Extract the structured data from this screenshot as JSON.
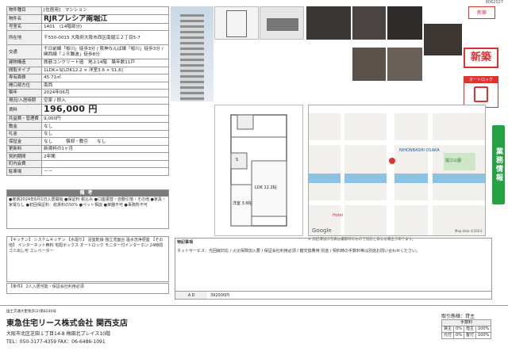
{
  "spec_rows": [
    {
      "label": "物件種目",
      "value": "[住居用]　マンション"
    },
    {
      "label": "物件名",
      "value": "RJRプレシア南堀江"
    },
    {
      "label": "号室名",
      "value": "1401　(14階部分)"
    },
    {
      "label": "所在地",
      "value": "〒550-0015 大阪府大阪市西区南堀江２丁目5-7"
    },
    {
      "label": "交通",
      "value": "千日前線「桜川」徒歩3分 / 阪神なんば線「桜川」徒歩3分 / 関西線「ＪＲ難波」徒歩8分"
    },
    {
      "label": "建物構造",
      "value": "鉄筋コンクリート造　地上14階　築年数11戸"
    },
    {
      "label": "間取タイプ",
      "value": "1LDK+S[LDK12.2 × 洋室3.6 × S1.6]"
    },
    {
      "label": "専有面積",
      "value": "45.71㎡"
    },
    {
      "label": "開口部方位",
      "value": "南西"
    },
    {
      "label": "築年",
      "value": "2024年06月"
    },
    {
      "label": "現況/入居時期",
      "value": "空家 / 即入"
    }
  ],
  "rent_label": "賃料",
  "rent_value": "196,000 円",
  "badge_new": "新築",
  "fee_rows": [
    {
      "label": "共益費・管理費",
      "value": "9,000円"
    },
    {
      "label": "敷金",
      "value": "なし"
    },
    {
      "label": "礼金",
      "value": "なし"
    },
    {
      "label": "保証金",
      "value": "なし　　　償却・敷引　　なし"
    },
    {
      "label": "更新料",
      "value": "新賃料の1ヶ月"
    },
    {
      "label": "契約期間",
      "value": "2年間"
    },
    {
      "label": "町内会費",
      "value": ""
    },
    {
      "label": "駐車場",
      "value": "－－"
    }
  ],
  "notes_head": "備考",
  "notes_text": "●家賃2024年6月1日入居開始 ●保証料 税込み ●口座振替・自動引落・その他 ●家具・家電なし ●初回保証料：総賃料の50% ●ペット相談 ●楽器不可 ●事務所不可",
  "equip_text": "【キッチン】 システムキッチン 【水廻り】 浴室乾燥 独立洗面台 温水洗浄便座 【その他】 インターネット無料 宅配ボックス オートロック モニター付インターホン 24時間ゴミ出し可 エレベーター",
  "cond_text": "【条件】 2人入居可能・保証会社利用必須",
  "remarks_head": "特記事項",
  "remarks_text": "ネットサービス：光回線対応 / 火災保険加入要 / 保証会社利用必須 / 鍵交換費用 別途 / 契約時の手数料等は別途お問い合わせください。",
  "ad_label": "ＡＤ",
  "ad_value": "392000円",
  "map_labels": {
    "station": "NIHONBASHI OSAKA",
    "park": "堀江公園",
    "hotel": "Hotel",
    "google": "Google",
    "copyright": "Map data ©2024"
  },
  "map_caption": "※ 周辺環境の写真は撮影時のもので現状と異なる場合があります。",
  "floor_labels": {
    "ldk": "LDK 12.2帖",
    "western": "洋室 3.6帖",
    "s": "S"
  },
  "icons": {
    "top": "新築",
    "side_text": "オートロック"
  },
  "side_button": "業務情報",
  "footer": {
    "license": "国土交通大臣免許(2)第8240号",
    "company": "東急住宅リース株式会社 関西支店",
    "address": "大阪市北区芝田１丁目14-8 梅田北プレイス10階",
    "tel": "TEL：050-3177-4359  FAX：06-6486-1091",
    "trade_label": "取引態様：",
    "trade_value": "貸主",
    "fee_head": "手数料",
    "fee_rows": [
      [
        "貸主",
        "0%",
        "借主",
        "100%"
      ],
      [
        "元付",
        "0%",
        "客付",
        "100%"
      ]
    ]
  },
  "page_number": "8062027"
}
